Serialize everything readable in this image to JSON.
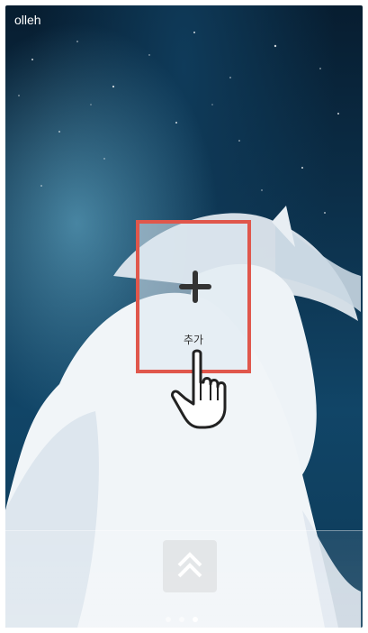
{
  "status_bar": {
    "carrier": "olleh"
  },
  "widget": {
    "add_label": "추가",
    "highlight_color": "#e0574c"
  },
  "pager": {
    "pages": 3,
    "active_index": 2
  },
  "icons": {
    "add": "plus-icon",
    "cursor": "hand-pointer-icon",
    "unlock": "double-chevron-up-icon"
  }
}
